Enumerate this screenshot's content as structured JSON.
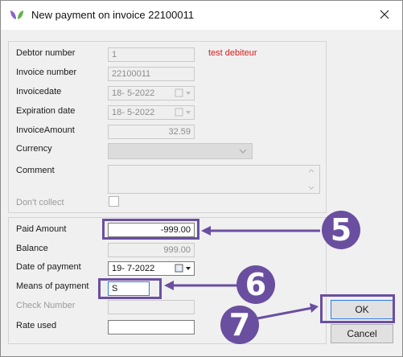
{
  "window": {
    "title": "New payment on invoice 22100011",
    "icon": "brand-leaf-icon"
  },
  "invoice": {
    "debtor_number_label": "Debtor number",
    "debtor_number": "1",
    "debtor_name": "test debiteur",
    "invoice_number_label": "Invoice number",
    "invoice_number": "22100011",
    "invoicedate_label": "Invoicedate",
    "invoicedate": "18-  5-2022",
    "expiration_label": "Expiration date",
    "expiration": "18-  5-2022",
    "amount_label": "InvoiceAmount",
    "amount": "32.59",
    "currency_label": "Currency",
    "currency": "",
    "comment_label": "Comment",
    "comment": "",
    "dont_collect_label": "Don't collect",
    "dont_collect": false
  },
  "payment": {
    "paid_amount_label": "Paid Amount",
    "paid_amount": "-999.00",
    "balance_label": "Balance",
    "balance": "999.00",
    "date_label": "Date of payment",
    "date": "19-  7-2022",
    "means_label": "Means of payment",
    "means": "S",
    "check_label": "Check Number",
    "check": "",
    "rate_label": "Rate used",
    "rate": ""
  },
  "buttons": {
    "ok": "OK",
    "cancel": "Cancel"
  },
  "annotations": {
    "step_5": "5",
    "step_6": "6",
    "step_7": "7",
    "color": "#6a4fa0"
  },
  "colors": {
    "debtor_name": "#d81b1b",
    "ok_border": "#2c7be5"
  }
}
